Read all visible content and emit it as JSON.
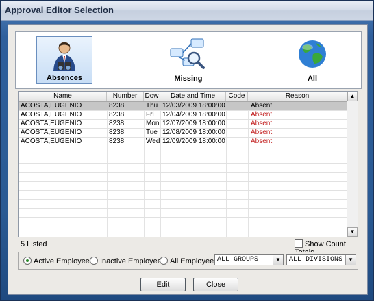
{
  "window": {
    "title": "Approval Editor Selection"
  },
  "modes": [
    {
      "label": "Absences",
      "icon": "absences-user-binoculars-icon",
      "selected": true
    },
    {
      "label": "Missing",
      "icon": "missing-network-search-icon",
      "selected": false
    },
    {
      "label": "All",
      "icon": "all-globe-icon",
      "selected": false
    }
  ],
  "table": {
    "columns": [
      "Name",
      "Number",
      "Dow",
      "Date and Time",
      "Code",
      "Reason"
    ],
    "rows": [
      [
        "ACOSTA,EUGENIO",
        "8238",
        "Thu",
        "12/03/2009 18:00:00",
        "",
        "Absent"
      ],
      [
        "ACOSTA,EUGENIO",
        "8238",
        "Fri",
        "12/04/2009 18:00:00",
        "",
        "Absent"
      ],
      [
        "ACOSTA,EUGENIO",
        "8238",
        "Mon",
        "12/07/2009 18:00:00",
        "",
        "Absent"
      ],
      [
        "ACOSTA,EUGENIO",
        "8238",
        "Tue",
        "12/08/2009 18:00:00",
        "",
        "Absent"
      ],
      [
        "ACOSTA,EUGENIO",
        "8238",
        "Wed",
        "12/09/2009 18:00:00",
        "",
        "Absent"
      ]
    ],
    "scroll_up": "▲",
    "scroll_down": "▼"
  },
  "status": {
    "listed": "5 Listed",
    "show_count_totals": "Show Count Totals"
  },
  "filters": {
    "active": "Active Employees",
    "inactive": "Inactive Employees",
    "all": "All Employees",
    "selected": "active",
    "groups": "ALL GROUPS",
    "divisions": "ALL DIVISIONS"
  },
  "buttons": {
    "edit": "Edit",
    "close": "Close"
  },
  "colors": {
    "reason": "#c01818",
    "selected_row": "#c6c6c6"
  }
}
